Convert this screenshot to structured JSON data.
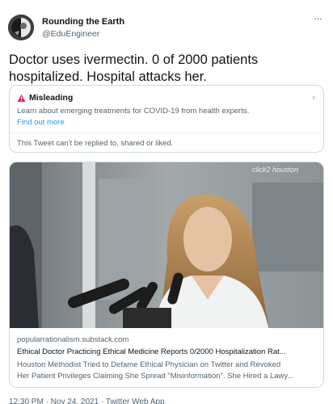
{
  "author": {
    "name": "Rounding the Earth",
    "handle": "@EduEngineer"
  },
  "tweet": {
    "text": "Doctor uses ivermectin. 0 of 2000 patients hospitalized. Hospital attacks her."
  },
  "notice": {
    "icon": "warning-icon",
    "title": "Misleading",
    "description": "Learn about emerging treatments for COVID-19 from health experts.",
    "link": "Find out more",
    "footer": "This Tweet can't be replied to, shared or liked."
  },
  "card": {
    "image_watermark": "click2 houston",
    "domain": "popularrationalism.substack.com",
    "title": "Ethical Doctor Practicing Ethical Medicine Reports 0/2000 Hospitalization Rat...",
    "description_line1": "Houston Methodist Tried to Defame Ethical Physician on Twitter and Revoked",
    "description_line2": "Her Patient Privileges Claiming She Spread \"Misinformation\". She Hired a Lawy..."
  },
  "meta": {
    "timestamp": "12:30 PM · Nov 24, 2021 · Twitter Web App"
  },
  "colors": {
    "accent": "#1d9bf0",
    "warning": "#e0245e",
    "border": "#cfd9de",
    "secondary_text": "#536471"
  }
}
